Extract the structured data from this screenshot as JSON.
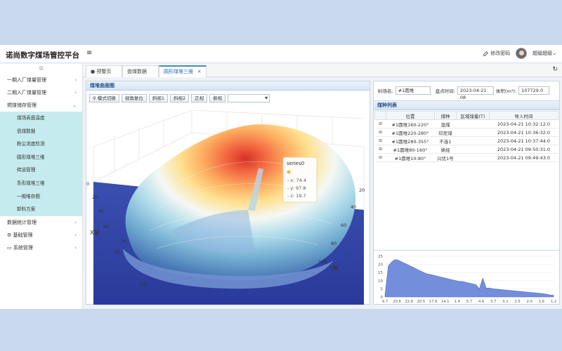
{
  "app": {
    "title": "诺尚数字煤场管控平台",
    "menu_toggle": "≡"
  },
  "header": {
    "change_password": "修改密码",
    "user": "超级超级"
  },
  "sidebar": {
    "tool": "▥",
    "groups": [
      {
        "label": "一期入厂煤量管理",
        "chevron": "‹"
      },
      {
        "label": "二期入厂煤量管理",
        "chevron": "‹"
      },
      {
        "label": "燃煤储存管理",
        "chevron": "⌄"
      }
    ],
    "subitems": [
      "煤场表面温度",
      "盘煤数据",
      "粉尘浓度检测",
      "圆形煤堆三维",
      "转运管理",
      "条形煤堆三维",
      "一期堆存图",
      "卸料方案"
    ],
    "bottom_groups": [
      {
        "label": "数据统计管理",
        "chevron": "‹"
      },
      {
        "label": "基础管理",
        "chevron": "‹"
      },
      {
        "label": "系统管理",
        "chevron": "‹"
      }
    ]
  },
  "tabs": [
    {
      "label": "预警页",
      "icon": "●"
    },
    {
      "label": "盘煤数据",
      "close": "✕"
    },
    {
      "label": "圆形煤堆三维",
      "close": "✕"
    }
  ],
  "refresh_icon": "↻",
  "left_panel": {
    "title": "煤堆曲面图",
    "buttons": [
      "模式切换",
      "视角复位",
      "斜视1",
      "斜视2",
      "正视",
      "俯视"
    ],
    "x_axis_label": "X轴",
    "y_axis_label": "Y轴",
    "x_ticks": [
      "0",
      "20",
      "40",
      "60",
      "74",
      "80",
      "100"
    ],
    "y_ticks": [
      "20",
      "40",
      "60",
      "80",
      "100"
    ],
    "tooltip": {
      "series": "series0",
      "x": "- x: 74.4",
      "y": "- y: 97.8",
      "z": "- z: 19.7"
    }
  },
  "right_panel": {
    "field_label": "料场名:",
    "field_value": "#1圆堆",
    "time_label": "盘点时间:",
    "time_value": "2023-04-21 08",
    "volume_label": "体积(m³):",
    "volume_value": "107729.0",
    "list_title": "煤种列表",
    "columns": [
      "位置",
      "煤种",
      "区域煤量(T)",
      "导入时间"
    ],
    "rows": [
      {
        "position": "#1圆堆160-220°",
        "type": "混煤",
        "amount": "",
        "time": "2023-04-21 10:32:12.0"
      },
      {
        "position": "#1圆堆220-280°",
        "type": "印尼煤",
        "amount": "",
        "time": "2023-04-21 10:36:32.0"
      },
      {
        "position": "#1圆堆280-355°",
        "type": "不连1",
        "amount": "",
        "time": "2023-04-21 10:37:44.0"
      },
      {
        "position": "#1圆堆80-160°",
        "type": "烯烃",
        "amount": "",
        "time": "2023-04-21 09:50:31.0"
      },
      {
        "position": "#1圆堆10-80°",
        "type": "兴优1号",
        "amount": "",
        "time": "2023-04-21 09:49:43.0"
      }
    ]
  },
  "chart_data": {
    "type": "area",
    "title": "",
    "xlabel": "",
    "ylabel": "",
    "ylim": [
      0,
      25
    ],
    "yticks": [
      "0",
      "5",
      "10",
      "15",
      "20",
      "25"
    ],
    "x_tick_labels": [
      "9.7",
      "20.6",
      "22.6",
      "20.5",
      "17.9",
      "14.1",
      "1.4",
      "5.7",
      "4.6",
      "3.7",
      "3.1",
      "2.5",
      "2.0",
      "1.6",
      "1.2"
    ],
    "color": "#5b7bd5",
    "values": [
      1,
      19,
      21.5,
      23,
      22.5,
      21.5,
      20.5,
      19.5,
      18.5,
      17.5,
      16.5,
      15.5,
      14.5,
      14,
      13.5,
      13,
      12.5,
      12,
      11.5,
      11,
      10.5,
      10,
      9.5,
      9.5,
      9,
      8.5,
      8,
      7.5,
      5,
      11.5,
      5.5,
      5.5,
      5,
      4.8,
      4.6,
      4.4,
      4.2,
      4,
      3.8,
      3.6,
      3.4,
      3.2,
      3,
      2.8,
      2.6,
      2.4,
      2.2,
      2,
      1.6,
      1.2,
      1
    ]
  }
}
